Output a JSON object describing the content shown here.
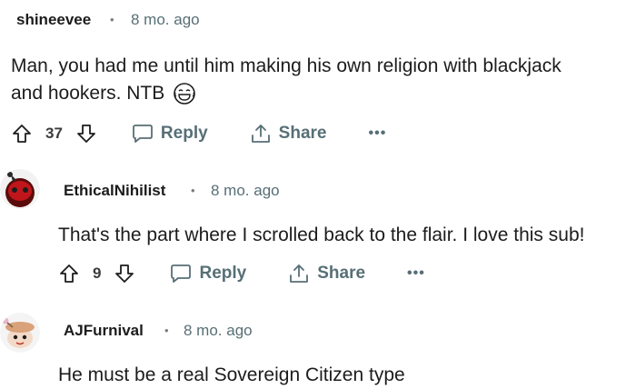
{
  "comments": [
    {
      "username": "shineevee",
      "separator": "•",
      "timestamp": "8 mo. ago",
      "body_line1": "Man, you had me until him making his own religion with blackjack",
      "body_line2": "and hookers. NTB",
      "emoji": "grinning-tears-emoji",
      "votes": "37",
      "reply_label": "Reply",
      "share_label": "Share",
      "more_label": "•••"
    },
    {
      "username": "EthicalNihilist",
      "separator": "•",
      "timestamp": "8 mo. ago",
      "body_line1": "That's the part where I scrolled back to the flair. I love this sub!",
      "votes": "9",
      "reply_label": "Reply",
      "share_label": "Share",
      "more_label": "•••",
      "avatar": "red-snoo-avatar"
    },
    {
      "username": "AJFurnival",
      "separator": "•",
      "timestamp": "8 mo. ago",
      "body_line1": "He must be a real Sovereign Citizen type",
      "avatar": "cartoon-snoo-avatar"
    }
  ],
  "colors": {
    "meta_gray": "#576f76",
    "text": "#1c1c1c",
    "background": "#ffffff"
  }
}
